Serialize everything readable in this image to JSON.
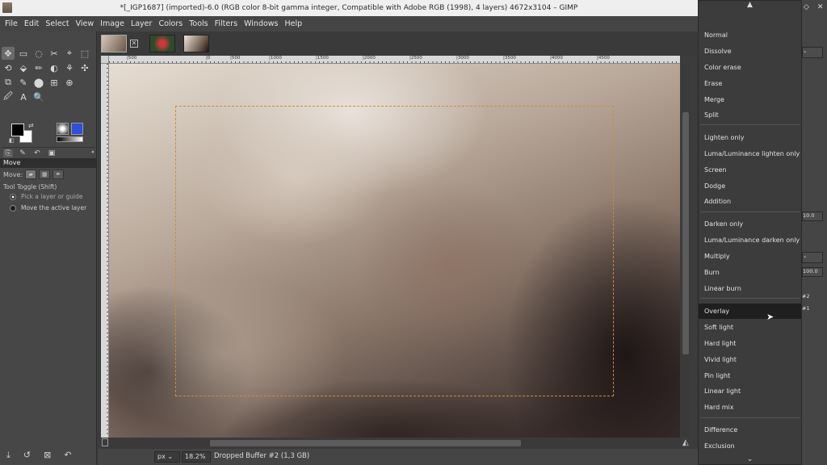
{
  "window": {
    "title": "*[_IGP1687] (imported)-6.0 (RGB color 8-bit gamma integer, Compatible with Adobe RGB (1998), 4 layers) 4672x3104 – GIMP"
  },
  "menubar": [
    "File",
    "Edit",
    "Select",
    "View",
    "Image",
    "Layer",
    "Colors",
    "Tools",
    "Filters",
    "Windows",
    "Help"
  ],
  "toolbox": {
    "tools_row1": [
      "✥",
      "▭",
      "◌",
      "✂",
      "⌖",
      "⬚"
    ],
    "tools_row2": [
      "⟲",
      "⬙",
      "✏",
      "◐",
      "⚘",
      "✣"
    ],
    "tools_row3": [
      "⧉",
      "✎",
      "⬤",
      "⊞",
      "⊕"
    ],
    "tools_row4": [
      "🖉",
      "A",
      "🔍"
    ],
    "options_title": "Move",
    "move_label": "Move:",
    "tool_toggle": "Tool Toggle  (Shift)",
    "radio_1": "Pick a layer or guide",
    "radio_2": "Move the active layer"
  },
  "ruler": {
    "h_ticks": [
      "|500",
      "|0",
      "|500",
      "|1000",
      "|1500",
      "|2000",
      "|2500",
      "|3000",
      "|3500",
      "|4000",
      "|4500"
    ]
  },
  "statusbar": {
    "unit": "px",
    "zoom": "18.2%",
    "message": "Dropped Buffer #2 (1,3 GB)"
  },
  "blend_menu": {
    "items": [
      "Normal",
      "Dissolve",
      "Color erase",
      "Erase",
      "Merge",
      "Split",
      "Lighten only",
      "Luma/Luminance lighten only",
      "Screen",
      "Dodge",
      "Addition",
      "Darken only",
      "Luma/Luminance darken only",
      "Multiply",
      "Burn",
      "Linear burn",
      "Overlay",
      "Soft light",
      "Hard light",
      "Vivid light",
      "Pin light",
      "Linear light",
      "Hard mix",
      "Difference",
      "Exclusion"
    ],
    "selected": "Overlay"
  },
  "dock": {
    "mode_value": "10.0",
    "opacity_value": "100.0",
    "layer_a": "#2",
    "layer_b": "#1"
  },
  "colors": {
    "fg": "#000000",
    "bg": "#ffffff",
    "selection": "#d08a3a"
  }
}
